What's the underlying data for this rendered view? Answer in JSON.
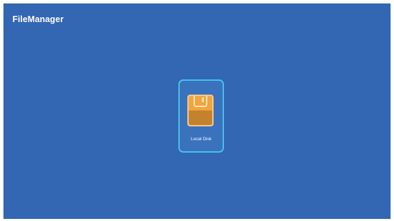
{
  "app": {
    "title": "FileManager"
  },
  "drives": [
    {
      "label": "Local Disk",
      "icon": "disk-icon",
      "selected": true
    }
  ],
  "colors": {
    "background": "#3366b3",
    "tile_border": "#43c4e9",
    "icon_orange": "#f2a43d",
    "icon_dark_orange": "#c4812e"
  }
}
